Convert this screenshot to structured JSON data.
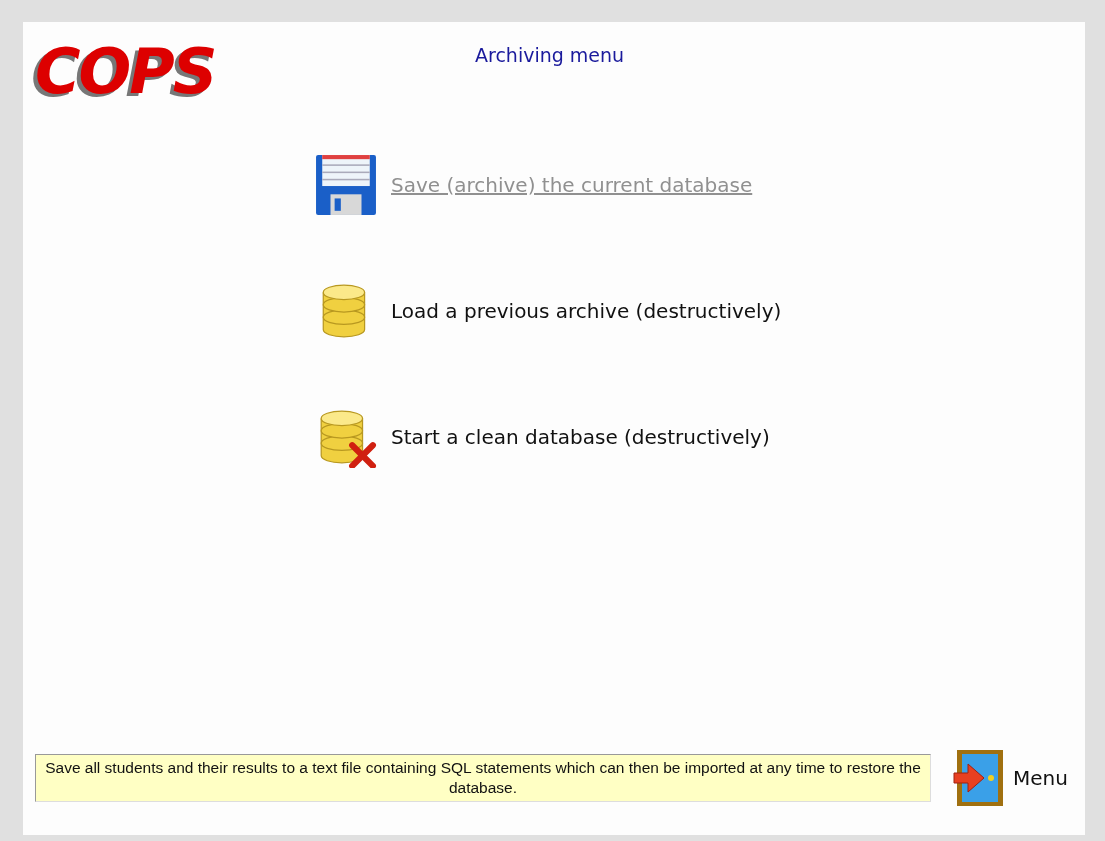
{
  "logo": "COPS",
  "title": "Archiving menu",
  "options": [
    {
      "kind": "floppy",
      "label": "Save (archive) the current database",
      "hovered": true
    },
    {
      "kind": "database",
      "label": "Load a previous archive (destructively)",
      "hovered": false
    },
    {
      "kind": "database-delete",
      "label": "Start a clean database (destructively)",
      "hovered": false
    }
  ],
  "hint": "Save all students and their results to a text file containing SQL statements which can then be imported at any time to restore the database.",
  "menu_button": "Menu"
}
